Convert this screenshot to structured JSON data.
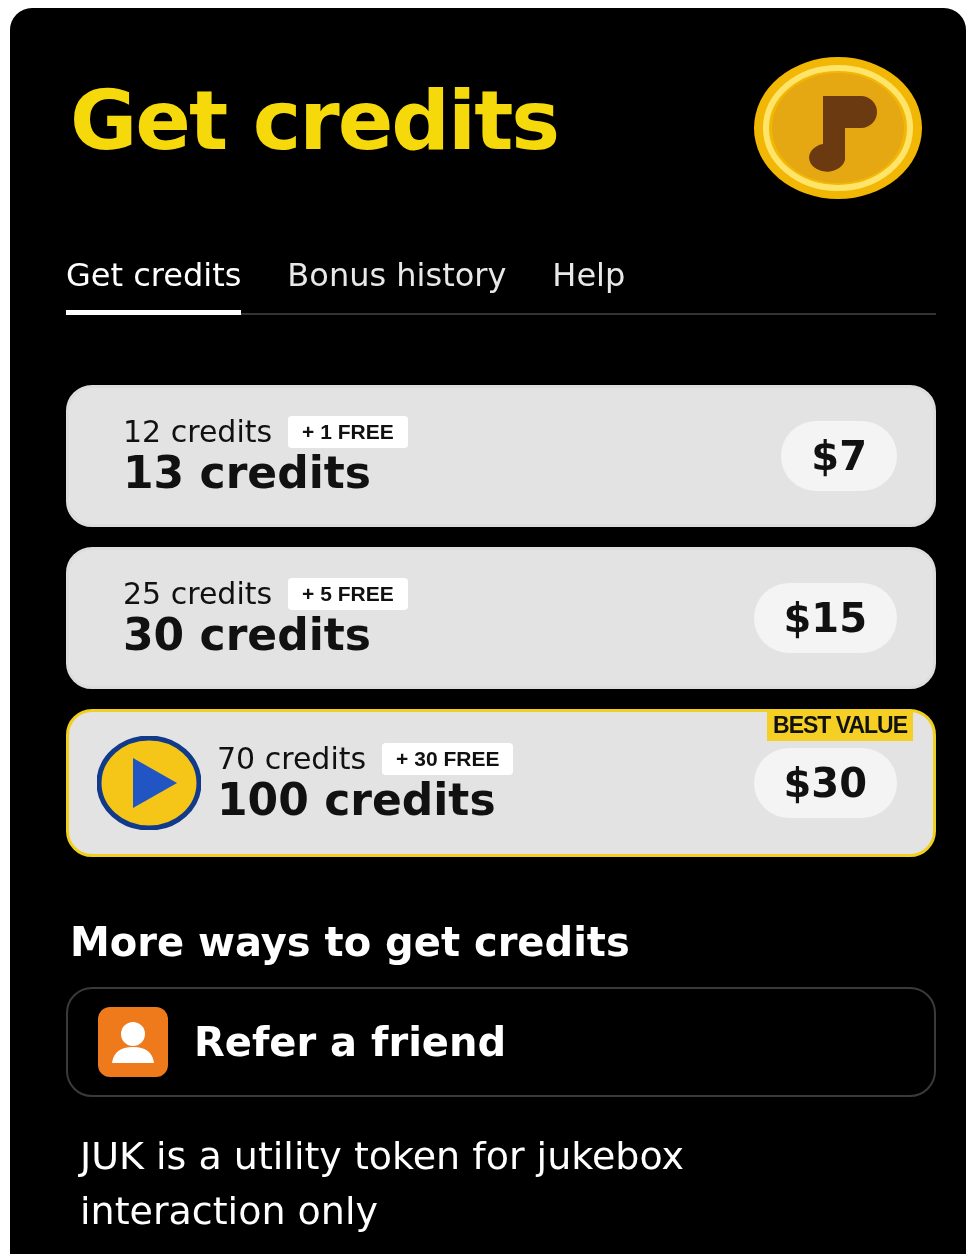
{
  "header": {
    "title": "Get credits"
  },
  "tabs": [
    {
      "label": "Get credits",
      "selected": true
    },
    {
      "label": "Bonus history",
      "selected": false
    },
    {
      "label": "Help",
      "selected": false
    }
  ],
  "packages": [
    {
      "base": "12 credits",
      "bonus": "+ 1 FREE",
      "total": "13 credits",
      "price": "$7",
      "highlighted": false
    },
    {
      "base": "25 credits",
      "bonus": "+ 5 FREE",
      "total": "30 credits",
      "price": "$15",
      "highlighted": false
    },
    {
      "base": "70 credits",
      "bonus": "+ 30 FREE",
      "total": "100 credits",
      "price": "$30",
      "highlighted": true,
      "badge": "BEST VALUE"
    }
  ],
  "more_ways": {
    "heading": "More ways to get credits",
    "items": [
      {
        "label": "Refer a friend"
      }
    ]
  },
  "footnote": "JUK is a utility token for jukebox interaction only"
}
